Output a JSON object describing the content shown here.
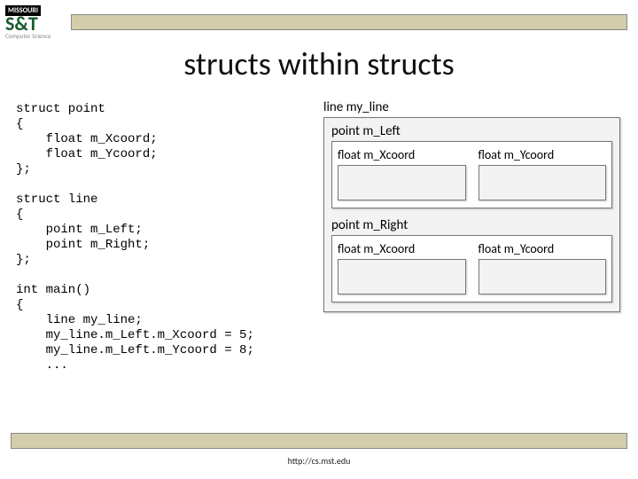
{
  "logo": {
    "top": "MISSOURI",
    "st": "S&T",
    "sub": "Computer Science"
  },
  "title": "structs within structs",
  "code": "struct point\n{\n    float m_Xcoord;\n    float m_Ycoord;\n};\n\nstruct line\n{\n    point m_Left;\n    point m_Right;\n};\n\nint main()\n{\n    line my_line;\n    my_line.m_Left.m_Xcoord = 5;\n    my_line.m_Left.m_Ycoord = 8;\n    ...",
  "diagram": {
    "outer_label": "line my_line",
    "left": {
      "label": "point m_Left",
      "x": "float m_Xcoord",
      "y": "float m_Ycoord"
    },
    "right": {
      "label": "point m_Right",
      "x": "float m_Xcoord",
      "y": "float m_Ycoord"
    }
  },
  "footer": "http://cs.mst.edu"
}
